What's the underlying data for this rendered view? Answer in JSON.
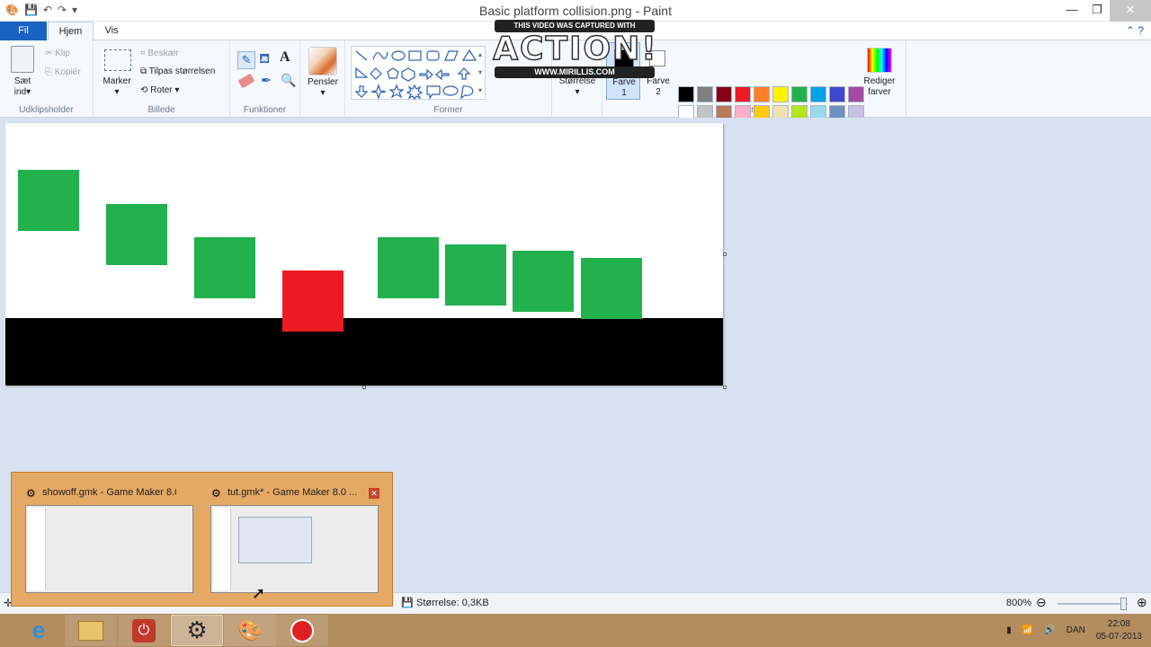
{
  "window": {
    "title": "Basic platform collision.png - Paint"
  },
  "tabs": [
    "Fil",
    "Hjem",
    "Vis"
  ],
  "ribbon": {
    "clipboard": {
      "paste": "Sæt",
      "paste2": "ind",
      "cut": "Klip",
      "copy": "Kopiér",
      "label": "Udklipsholder"
    },
    "image": {
      "select": "Marker",
      "crop": "Beskær",
      "resize": "Tilpas størrelsen",
      "rotate": "Roter",
      "label": "Billede"
    },
    "tools": {
      "label": "Funktioner"
    },
    "brushes": {
      "label": "Pensler"
    },
    "shapes": {
      "label": "Former"
    },
    "size": {
      "label": "Størrelse"
    },
    "color1": {
      "line1": "Farve",
      "line2": "1"
    },
    "color2": {
      "line1": "Farve",
      "line2": "2"
    },
    "colors": {
      "label": "Farver"
    },
    "edit_colors": {
      "line1": "Rediger",
      "line2": "farver"
    },
    "palette": [
      "#000000",
      "#7f7f7f",
      "#880015",
      "#ed1c24",
      "#ff7f27",
      "#fff200",
      "#22b14c",
      "#00a2e8",
      "#3f48cc",
      "#a349a4",
      "#ffffff",
      "#c3c3c3",
      "#b97a57",
      "#ffaec9",
      "#ffc90e",
      "#efe4b0",
      "#b5e61d",
      "#99d9ea",
      "#7092be",
      "#c8bfe7",
      "#ffffff",
      "#ffffff",
      "#ffffff",
      "#ffffff",
      "#ffffff",
      "#ffffff",
      "#ffffff",
      "#ffffff",
      "#ffffff",
      "#ffffff"
    ]
  },
  "watermark": {
    "top": "THIS VIDEO WAS CAPTURED WITH",
    "logo": "ACTION!",
    "bottom": "WWW.MIRILLIS.COM"
  },
  "status": {
    "size": "Størrelse: 0,3KB",
    "zoom": "800%"
  },
  "thumbnails": [
    {
      "title": "showoff.gmk - Game Maker 8.0 ..."
    },
    {
      "title": "tut.gmk* - Game Maker 8.0 ..."
    }
  ],
  "tray": {
    "lang": "DAN",
    "time": "22:08",
    "date": "05-07-2013"
  },
  "colors": {
    "green": "#22b14c",
    "red": "#ed1c24",
    "black": "#000000"
  }
}
